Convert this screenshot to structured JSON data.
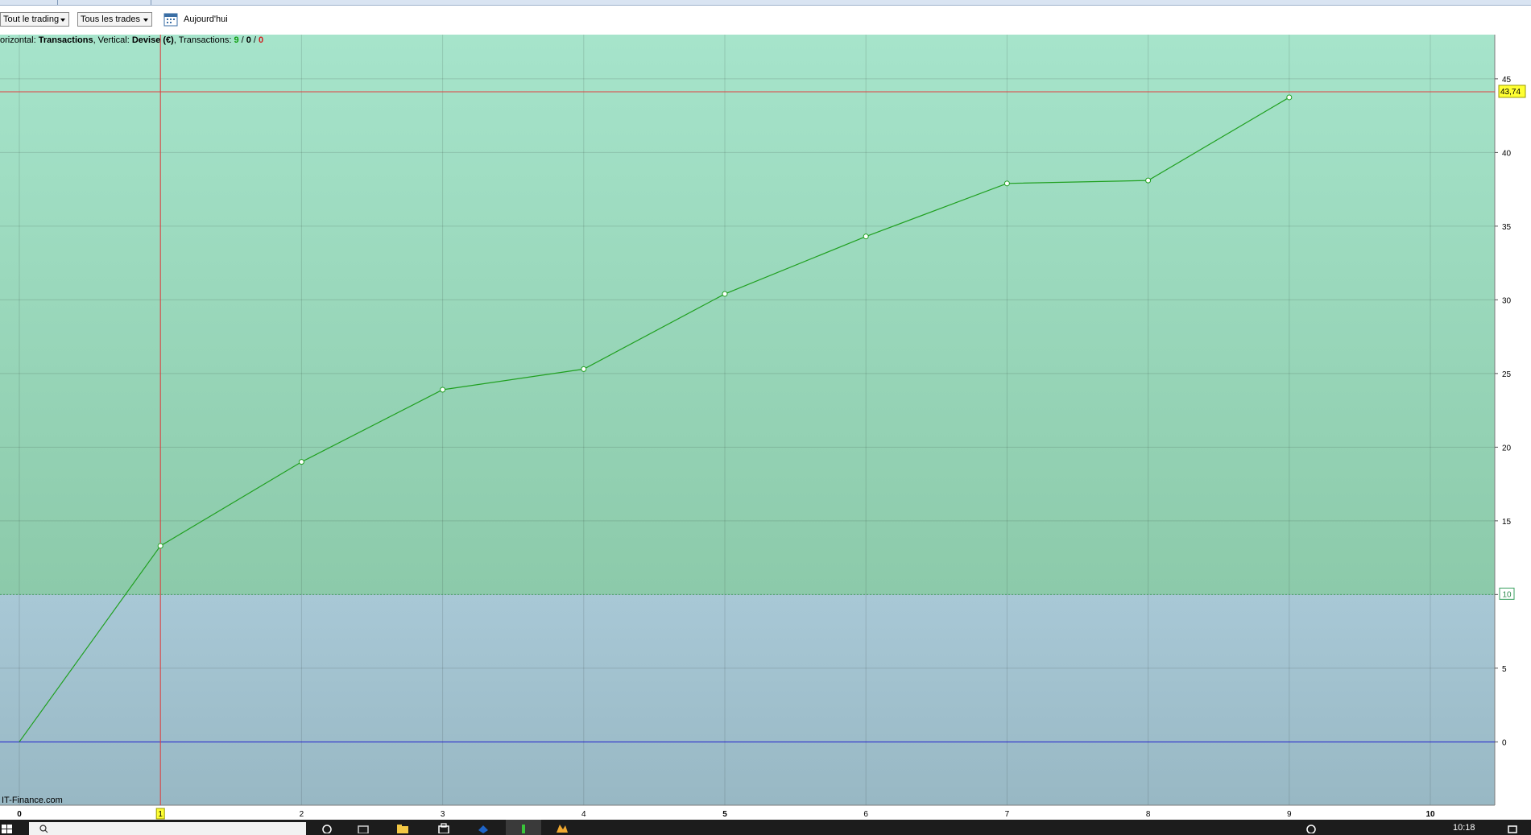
{
  "toolbar": {
    "dropdown_trading": "Tout le trading",
    "dropdown_trades": "Tous les trades",
    "today_label": "Aujourd'hui"
  },
  "chart_info": {
    "horizontal_prefix": "orizontal: ",
    "horizontal_value": "Transactions",
    "vertical_prefix": ", Vertical: ",
    "vertical_value": "Devise (€)",
    "transactions_prefix": ", Transactions: ",
    "count_total": "9",
    "sep1": " / ",
    "count_mid": "0",
    "sep2": " / ",
    "count_last": "0"
  },
  "watermark": "IT-Finance.com",
  "taskbar": {
    "time": "10:18"
  },
  "colors": {
    "profit_zone_top": "#a6e4cb",
    "profit_zone_bottom": "#8ccaaa",
    "base_zone_top": "#a8c8d6",
    "base_zone_bottom": "#98b8c4",
    "line": "#20a020",
    "crosshair": "#e04040",
    "zero_line": "#2020d0",
    "highlight": "#ffff33"
  },
  "chart_data": {
    "type": "line",
    "x": [
      0,
      1,
      2,
      3,
      4,
      5,
      6,
      7,
      8,
      9
    ],
    "values": [
      0,
      13.3,
      19.0,
      23.9,
      25.3,
      30.4,
      34.3,
      37.9,
      38.1,
      43.74
    ],
    "xlim": [
      0,
      10.5
    ],
    "ylim": [
      -4.3,
      48
    ],
    "x_ticks": [
      0,
      1,
      2,
      3,
      4,
      5,
      6,
      7,
      8,
      9,
      10
    ],
    "y_ticks": [
      0,
      5,
      10,
      15,
      20,
      25,
      30,
      35,
      40,
      45
    ],
    "threshold": 10,
    "highlight_x": 1,
    "last_value": 43.74,
    "last_value_label": "43,74",
    "grid": true
  }
}
